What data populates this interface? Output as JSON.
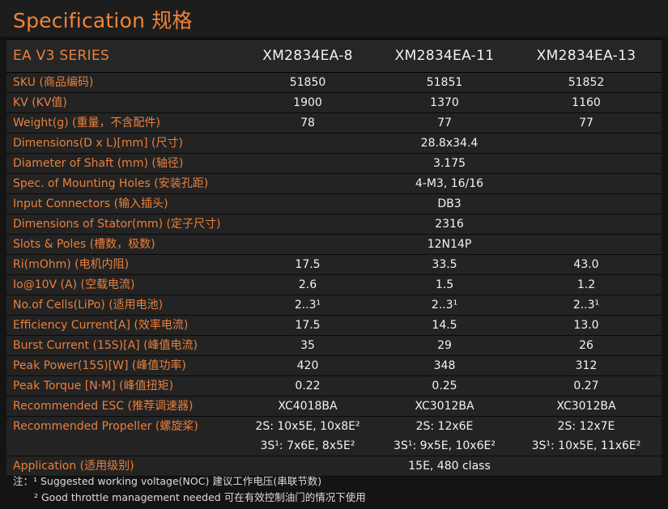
{
  "title": "Specification 规格",
  "header": {
    "series": "EA V3 SERIES",
    "models": [
      "XM2834EA-8",
      "XM2834EA-11",
      "XM2834EA-13"
    ]
  },
  "rows": [
    {
      "label": "SKU (商品编码)",
      "values": [
        "51850",
        "51851",
        "51852"
      ]
    },
    {
      "label": "KV (KV值)",
      "values": [
        "1900",
        "1370",
        "1160"
      ]
    },
    {
      "label": "Weight(g) (重量，不含配件)",
      "values": [
        "78",
        "77",
        "77"
      ]
    },
    {
      "label": "Dimensions(D x L)[mm] (尺寸)",
      "value": "28.8x34.4"
    },
    {
      "label": "Diameter of Shaft (mm) (轴径)",
      "value": "3.175"
    },
    {
      "label": "Spec. of Mounting Holes (安装孔距)",
      "value": "4-M3, 16/16"
    },
    {
      "label": "Input Connectors (输入插头)",
      "value": "DB3"
    },
    {
      "label": "Dimensions of Stator(mm) (定子尺寸)",
      "value": "2316"
    },
    {
      "label": "Slots & Poles (槽数，极数)",
      "value": "12N14P"
    },
    {
      "label": "Ri(mOhm) (电机内阻)",
      "values": [
        "17.5",
        "33.5",
        "43.0"
      ]
    },
    {
      "label": "Io@10V (A) (空载电流)",
      "values": [
        "2.6",
        "1.5",
        "1.2"
      ]
    },
    {
      "label": "No.of Cells(LiPo) (适用电池)",
      "values": [
        "2..3¹",
        "2..3¹",
        "2..3¹"
      ]
    },
    {
      "label": "Efficiency Current[A] (效率电流)",
      "values": [
        "17.5",
        "14.5",
        "13.0"
      ]
    },
    {
      "label": "Burst Current (15S)[A] (峰值电流)",
      "values": [
        "35",
        "29",
        "26"
      ]
    },
    {
      "label": "Peak Power(15S)[W] (峰值功率)",
      "values": [
        "420",
        "348",
        "312"
      ]
    },
    {
      "label": "Peak Torque [N·M] (峰值扭矩)",
      "values": [
        "0.22",
        "0.25",
        "0.27"
      ]
    },
    {
      "label": "Recommended ESC (推荐调速器)",
      "values": [
        "XC4018BA",
        "XC3012BA",
        "XC3012BA"
      ]
    }
  ],
  "propeller": {
    "label": "Recommended Propeller (螺旋桨)",
    "line1": [
      "2S: 10x5E, 10x8E²",
      "2S: 12x6E",
      "2S: 12x7E"
    ],
    "line2": [
      "3S¹: 7x6E, 8x5E²",
      "3S¹: 9x5E, 10x6E²",
      "3S¹: 10x5E, 11x6E²"
    ]
  },
  "application": {
    "label": "Application (适用级别)",
    "value": "15E, 480 class"
  },
  "notes": {
    "line1": "注：¹ Suggested working voltage(NOC) 建议工作电压(串联节数)",
    "line2": "² Good throttle management needed 可在有效控制油门的情况下使用"
  },
  "colors": {
    "accent": "#e9803c",
    "background": "#141414",
    "row": "#232323"
  }
}
